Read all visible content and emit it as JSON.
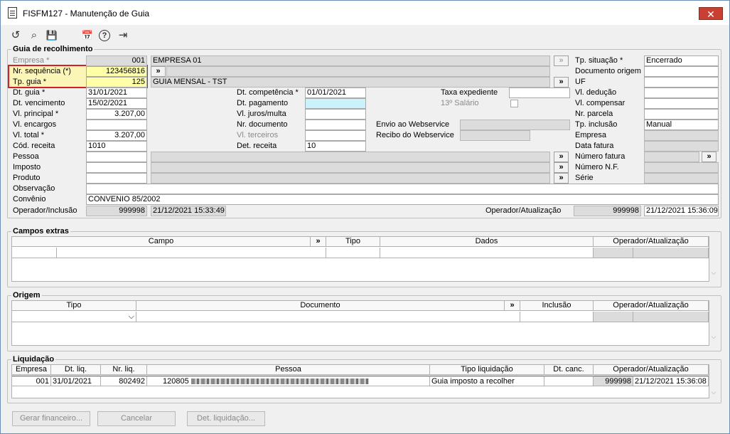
{
  "window": {
    "title": "FISFM127 - Manutenção de Guia",
    "close": "✕"
  },
  "toolbar": {
    "undo": "↺",
    "search": "⌕",
    "save": "💾",
    "calendar": "📅",
    "help": "?",
    "exit": "⇥"
  },
  "guia": {
    "title": "Guia de recolhimento",
    "empresa_label": "Empresa *",
    "empresa_code": "001",
    "empresa_name": "EMPRESA 01",
    "nrseq_label": "Nr. sequência (*)",
    "nrseq_value": "123456816",
    "tpguia_label": "Tp. guia *",
    "tpguia_value": "125",
    "tpguia_name": "GUIA MENSAL - TST",
    "dtguia_label": "Dt. guia *",
    "dtguia_value": "31/01/2021",
    "dtvenc_label": "Dt. vencimento",
    "dtvenc_value": "15/02/2021",
    "vlprinc_label": "Vl. principal *",
    "vlprinc_value": "3.207,00",
    "vlenc_label": "Vl. encargos",
    "vltotal_label": "Vl. total *",
    "vltotal_value": "3.207,00",
    "codrec_label": "Cód. receita",
    "codrec_value": "1010",
    "pessoa_label": "Pessoa",
    "imposto_label": "Imposto",
    "produto_label": "Produto",
    "obs_label": "Observação",
    "conv_label": "Convênio",
    "conv_value": "CONVENIO 85/2002",
    "opinc_label": "Operador/Inclusão",
    "opinc_value": "999998",
    "opinc_date": "21/12/2021 15:33:49",
    "dtcomp_label": "Dt. competência *",
    "dtcomp_value": "01/01/2021",
    "dtpag_label": "Dt. pagamento",
    "vljuros_label": "Vl. juros/multa",
    "nrdoc_label": "Nr. documento",
    "vlterc_label": "Vl. terceiros",
    "detrec_label": "Det. receita",
    "detrec_value": "10",
    "taxa_label": "Taxa expediente",
    "salario_label": "13º Salário",
    "envio_label": "Envio ao Webservice",
    "recibo_label": "Recibo do Webservice",
    "tpsit_label": "Tp. situação *",
    "tpsit_value": "Encerrado",
    "docorig_label": "Documento origem",
    "uf_label": "UF",
    "vlded_label": "Vl. dedução",
    "vlcomp_label": "Vl. compensar",
    "nrparc_label": "Nr. parcela",
    "tpinc_label": "Tp. inclusão",
    "tpinc_value": "Manual",
    "empresa2_label": "Empresa",
    "dtfat_label": "Data fatura",
    "nrfat_label": "Número fatura",
    "nrnf_label": "Número N.F.",
    "serie_label": "Série",
    "opatu_label": "Operador/Atualização",
    "opatu_value": "999998",
    "opatu_date": "21/12/2021 15:36:09",
    "more": "»"
  },
  "campos": {
    "title": "Campos extras",
    "col_campo": "Campo",
    "col_more": "»",
    "col_tipo": "Tipo",
    "col_dados": "Dados",
    "col_op": "Operador/Atualização"
  },
  "origem": {
    "title": "Origem",
    "col_tipo": "Tipo",
    "col_doc": "Documento",
    "col_more": "»",
    "col_inc": "Inclusão",
    "col_op": "Operador/Atualização",
    "dropdown": "⌵"
  },
  "liq": {
    "title": "Liquidação",
    "cols": [
      "Empresa",
      "Dt. liq.",
      "Nr. liq.",
      "Pessoa",
      "Tipo liquidação",
      "Dt. canc.",
      "Operador/Atualização"
    ],
    "row": {
      "empresa": "001",
      "dtliq": "31/01/2021",
      "nrliq": "802492",
      "pessoa_code": "120805",
      "tipo": "Guia imposto a recolher",
      "dtcanc": "",
      "op": "999998",
      "op_date": "21/12/2021 15:36:08"
    }
  },
  "buttons": {
    "gerar": "Gerar financeiro...",
    "cancelar": "Cancelar",
    "det": "Det. liquidação..."
  }
}
